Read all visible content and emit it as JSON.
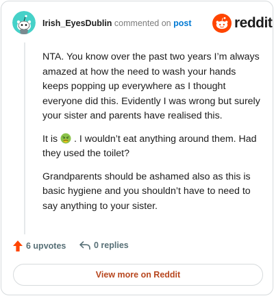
{
  "header": {
    "author": "Irish_EyesDublin",
    "verb": "commented on",
    "post_link": "post",
    "brand_word": "reddit"
  },
  "comment": {
    "paragraphs": [
      "NTA. You know over the past two years I’m always amazed at how the need to wash your hands keeps popping up everywhere as I thought everyone did this. Evidently I was wrong but surely your sister and parents have realised this.",
      "Grandparents should be ashamed also as this is basic hygiene and you shouldn’t have to need to say anything to your sister."
    ],
    "middle_before_emoji": "It is",
    "emoji": "nauseated-face-icon",
    "middle_after_emoji": ". I wouldn’t eat anything around them. Had they used the toilet?"
  },
  "footer": {
    "upvotes": "6 upvotes",
    "replies": "0 replies",
    "cta": "View more on Reddit"
  },
  "colors": {
    "brand_orange": "#ff4500",
    "link_blue": "#0079d3",
    "cta_text": "#b7461e",
    "meta_gray": "#576f76",
    "avatar_bg": "#46d1c8"
  }
}
